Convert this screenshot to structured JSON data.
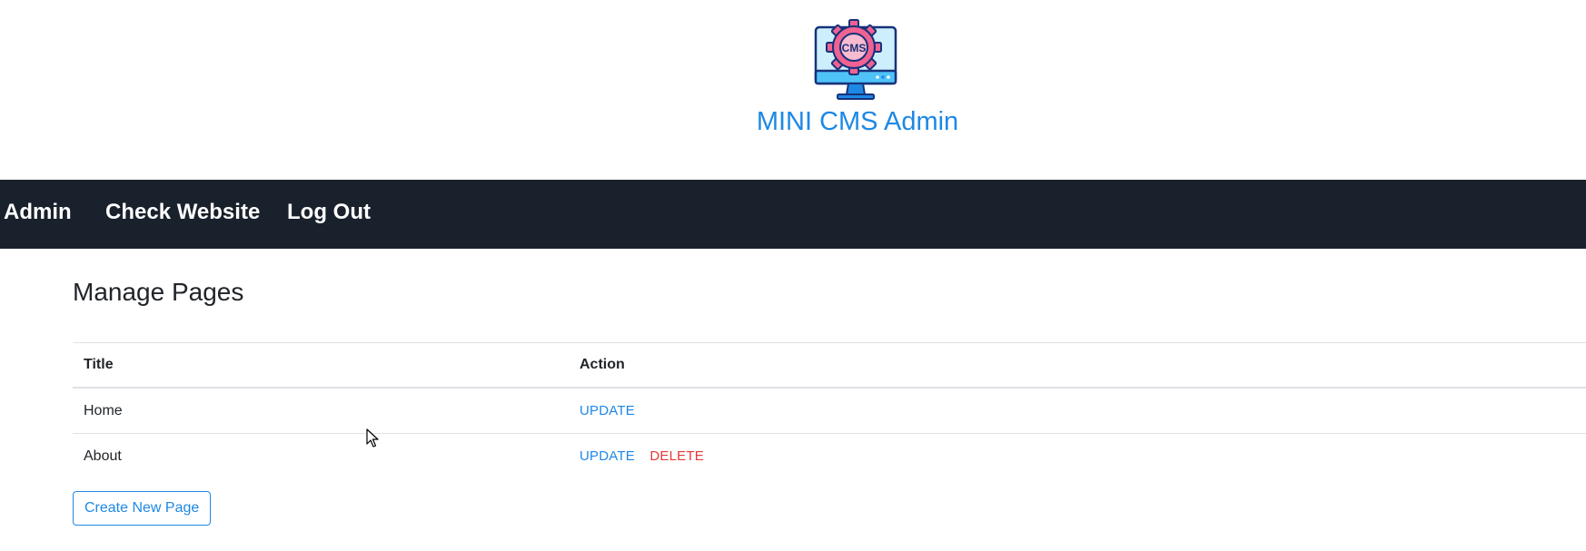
{
  "header": {
    "logo_text": "CMS",
    "title": "MINI CMS Admin"
  },
  "nav": {
    "items": [
      {
        "label": "Admin"
      },
      {
        "label": "Check Website"
      },
      {
        "label": "Log Out"
      }
    ]
  },
  "main": {
    "page_title": "Manage Pages",
    "table": {
      "columns": [
        "Title",
        "Action"
      ],
      "rows": [
        {
          "title": "Home",
          "actions": [
            "UPDATE"
          ]
        },
        {
          "title": "About",
          "actions": [
            "UPDATE",
            "DELETE"
          ]
        }
      ]
    },
    "create_button_label": "Create New Page"
  },
  "colors": {
    "accent": "#1e88e5",
    "danger": "#e53935",
    "navbar": "#19212c"
  },
  "icons": {
    "logo": "cms-monitor-gear-icon",
    "cursor": "mouse-pointer-icon"
  }
}
